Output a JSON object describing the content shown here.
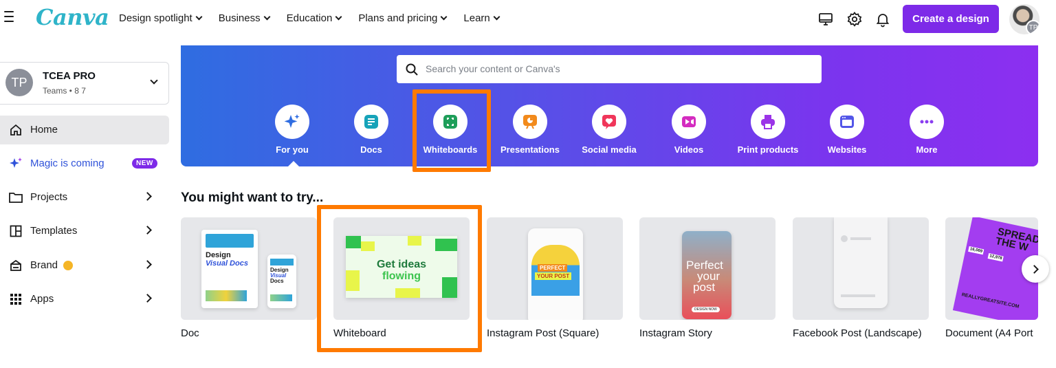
{
  "app": {
    "logo": "Canva"
  },
  "topnav": {
    "items": [
      {
        "label": "Design spotlight"
      },
      {
        "label": "Business"
      },
      {
        "label": "Education"
      },
      {
        "label": "Plans and pricing"
      },
      {
        "label": "Learn"
      }
    ],
    "create_label": "Create a design",
    "avatar_initials": "TP"
  },
  "sidebar": {
    "team": {
      "initials": "TP",
      "name": "TCEA PRO",
      "sub": "Teams • 8 7"
    },
    "items": [
      {
        "label": "Home",
        "icon": "home-icon"
      },
      {
        "label": "Magic is coming",
        "badge": "NEW",
        "icon": "sparkle-icon"
      },
      {
        "label": "Projects",
        "icon": "folder-icon"
      },
      {
        "label": "Templates",
        "icon": "templates-icon"
      },
      {
        "label": "Brand",
        "icon": "brand-icon"
      },
      {
        "label": "Apps",
        "icon": "apps-icon"
      }
    ]
  },
  "search": {
    "placeholder": "Search your content or Canva's"
  },
  "categories": [
    {
      "label": "For you",
      "icon": "sparkle-icon",
      "color": "#2f6de1"
    },
    {
      "label": "Docs",
      "icon": "doc-icon",
      "color": "#16a3b9"
    },
    {
      "label": "Whiteboards",
      "icon": "whiteboard-icon",
      "color": "#1e9e5a"
    },
    {
      "label": "Presentations",
      "icon": "presentation-icon",
      "color": "#f28a1b"
    },
    {
      "label": "Social media",
      "icon": "heart-icon",
      "color": "#f0365a"
    },
    {
      "label": "Videos",
      "icon": "video-icon",
      "color": "#d42cc0"
    },
    {
      "label": "Print products",
      "icon": "printer-icon",
      "color": "#9b34e8"
    },
    {
      "label": "Websites",
      "icon": "website-icon",
      "color": "#5356e8"
    },
    {
      "label": "More",
      "icon": "more-icon",
      "color": "#8a3df0"
    }
  ],
  "recommendations": {
    "title": "You might want to try...",
    "cards": [
      {
        "label": "Doc",
        "thumb_text": [
          "Design",
          "Visual Docs",
          "Design",
          "Visual",
          "Docs"
        ]
      },
      {
        "label": "Whiteboard",
        "thumb_text": [
          "Get ideas",
          "flowing"
        ]
      },
      {
        "label": "Instagram Post (Square)",
        "thumb_text": [
          "PERFECT",
          "YOUR POST"
        ]
      },
      {
        "label": "Instagram Story",
        "thumb_text": [
          "Perfect",
          "your",
          "post",
          "DESIGN NOW"
        ]
      },
      {
        "label": "Facebook Post (Landscape)"
      },
      {
        "label": "Document (A4 Port",
        "thumb_text": [
          "SPREAD",
          "THE W",
          "16,069",
          "12,978",
          "REALLYGREATSITE.COM"
        ]
      }
    ]
  },
  "colors": {
    "accent": "#7d2ae8",
    "highlight": "#ff7a00"
  }
}
